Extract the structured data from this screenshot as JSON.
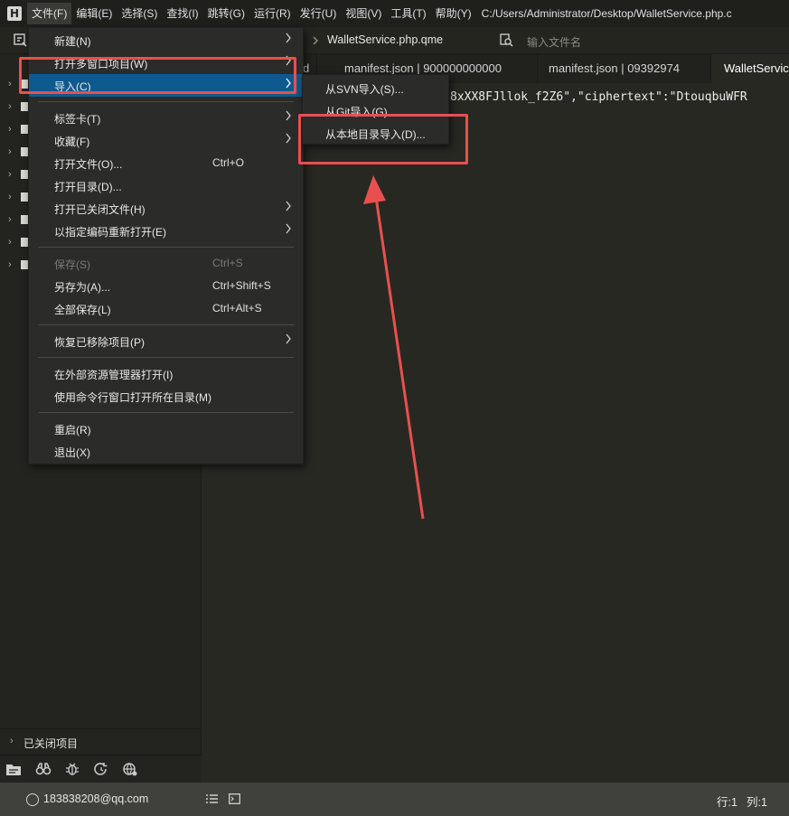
{
  "app": {
    "logo_letter": "H",
    "title_path": "C:/Users/Administrator/Desktop/WalletService.php.c"
  },
  "menubar": {
    "items": [
      "文件(F)",
      "编辑(E)",
      "选择(S)",
      "查找(I)",
      "跳转(G)",
      "运行(R)",
      "发行(U)",
      "视图(V)",
      "工具(T)",
      "帮助(Y)"
    ]
  },
  "toolbar": {
    "breadcrumb": "WalletService.php.qme",
    "file_search_placeholder": "输入文件名"
  },
  "tabs": [
    {
      "label": "d"
    },
    {
      "label": "manifest.json | 900000000000"
    },
    {
      "label": "manifest.json | 09392974"
    },
    {
      "label": "WalletServic"
    }
  ],
  "editor": {
    "code_line": "8xXX8FJllok_f2Z6\",\"ciphertext\":\"DtouqbuWFR"
  },
  "file_menu": {
    "items": [
      {
        "label": "新建(N)",
        "shortcut": "",
        "submenu": true
      },
      {
        "label": "打开多窗口项目(W)",
        "shortcut": "",
        "submenu": true
      },
      {
        "label": "导入(C)",
        "shortcut": "",
        "submenu": true,
        "highlighted": true
      },
      {
        "label": "标签卡(T)",
        "shortcut": "",
        "submenu": true
      },
      {
        "label": "收藏(F)",
        "shortcut": "",
        "submenu": true
      },
      {
        "label": "打开文件(O)...",
        "shortcut": "Ctrl+O"
      },
      {
        "label": "打开目录(D)..."
      },
      {
        "label": "打开已关闭文件(H)",
        "submenu": true
      },
      {
        "label": "以指定编码重新打开(E)",
        "submenu": true
      },
      {
        "label": "保存(S)",
        "shortcut": "Ctrl+S",
        "disabled": true
      },
      {
        "label": "另存为(A)...",
        "shortcut": "Ctrl+Shift+S"
      },
      {
        "label": "全部保存(L)",
        "shortcut": "Ctrl+Alt+S"
      },
      {
        "label": "恢复已移除项目(P)",
        "submenu": true
      },
      {
        "label": "在外部资源管理器打开(I)"
      },
      {
        "label": "使用命令行窗口打开所在目录(M)"
      },
      {
        "label": "重启(R)"
      },
      {
        "label": "退出(X)"
      }
    ]
  },
  "import_submenu": {
    "items": [
      "从SVN导入(S)...",
      "从Git导入(G)...",
      "从本地目录导入(D)..."
    ]
  },
  "sidebar": {
    "closed_projects_label": "已关闭项目"
  },
  "statusbar": {
    "user": "183838208@qq.com",
    "line": "行:1",
    "col": "列:1"
  },
  "colors": {
    "highlight": "#0e5a8e",
    "annotation": "#e8504f",
    "editor_bg": "#272822"
  },
  "icons": [
    "folder-icon",
    "search-icon",
    "binoculars-icon",
    "bug-icon",
    "refresh-icon",
    "globe-icon",
    "user-icon",
    "list-icon",
    "terminal-icon",
    "chevron-right-icon"
  ]
}
